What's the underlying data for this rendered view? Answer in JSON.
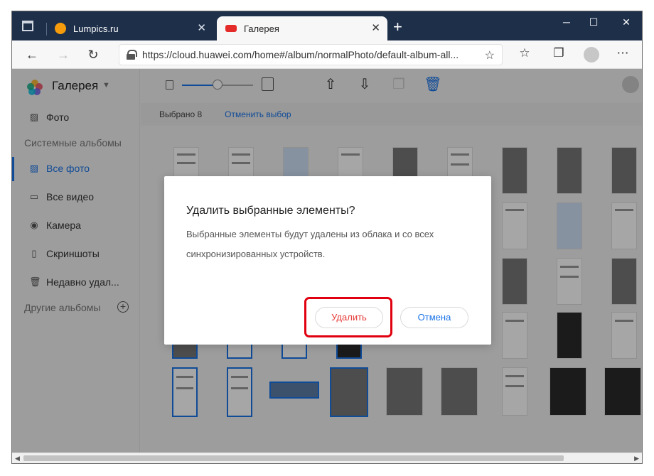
{
  "browser": {
    "tabs": [
      {
        "title": "Lumpics.ru",
        "active": false
      },
      {
        "title": "Галерея",
        "active": true
      }
    ],
    "address": "https://cloud.huawei.com/home#/album/normalPhoto/default-album-all..."
  },
  "sidebar": {
    "app_title": "Галерея",
    "items": [
      {
        "label": "Фото",
        "icon": "image-icon"
      },
      {
        "label": "Все фото",
        "icon": "image-icon",
        "active": true
      },
      {
        "label": "Все видео",
        "icon": "video-icon"
      },
      {
        "label": "Камера",
        "icon": "camera-icon"
      },
      {
        "label": "Скриншоты",
        "icon": "phone-icon"
      },
      {
        "label": "Недавно удал...",
        "icon": "trash-icon"
      }
    ],
    "system_albums_label": "Системные альбомы",
    "other_albums_label": "Другие альбомы"
  },
  "selection": {
    "count_label": "Выбрано 8",
    "cancel_label": "Отменить выбор"
  },
  "dialog": {
    "title": "Удалить выбранные элементы?",
    "text": "Выбранные элементы будут удалены из облака и со всех синхронизированных устройств.",
    "delete_label": "Удалить",
    "cancel_label": "Отмена"
  },
  "colors": {
    "accent": "#1a73e8",
    "danger": "#e53935",
    "highlight": "#e0000f",
    "titlebar": "#1e2f4a"
  }
}
